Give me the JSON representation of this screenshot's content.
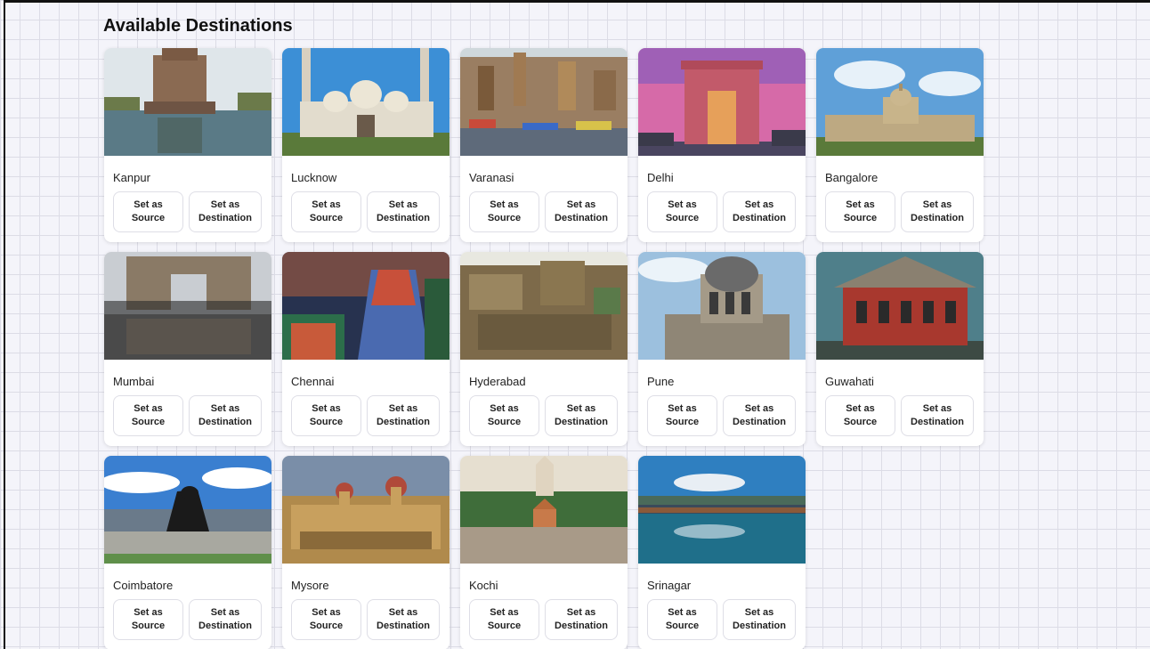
{
  "page": {
    "heading": "Available Destinations"
  },
  "buttons": {
    "source_line1": "Set as",
    "source_line2": "Source",
    "dest_line1": "Set as",
    "dest_line2": "Destination"
  },
  "destinations": [
    {
      "name": "Kanpur",
      "scene": "ghat-temple",
      "sky": "#dfe6ea",
      "ground": "#6b7a6a"
    },
    {
      "name": "Lucknow",
      "scene": "mosque",
      "sky": "#3c8fd6",
      "ground": "#a9a28c"
    },
    {
      "name": "Varanasi",
      "scene": "ghats",
      "sky": "#cfd8dc",
      "ground": "#8a6b55"
    },
    {
      "name": "Delhi",
      "scene": "gate",
      "sky": "#d66aa8",
      "ground": "#4a4560"
    },
    {
      "name": "Bangalore",
      "scene": "palace",
      "sky": "#5fa0d8",
      "ground": "#8c8a70"
    },
    {
      "name": "Mumbai",
      "scene": "gateway",
      "sky": "#c9cdd2",
      "ground": "#3b3b3b"
    },
    {
      "name": "Chennai",
      "scene": "gopuram",
      "sky": "#27324f",
      "ground": "#2c6e4a"
    },
    {
      "name": "Hyderabad",
      "scene": "fort",
      "sky": "#e8e8e0",
      "ground": "#7d6a4a"
    },
    {
      "name": "Pune",
      "scene": "dome",
      "sky": "#9cc0de",
      "ground": "#8f8676"
    },
    {
      "name": "Guwahati",
      "scene": "redbuilding",
      "sky": "#4f7f8a",
      "ground": "#3d4a44"
    },
    {
      "name": "Coimbatore",
      "scene": "statue",
      "sky": "#3a7fd0",
      "ground": "#5f8f4a"
    },
    {
      "name": "Mysore",
      "scene": "mysorepalace",
      "sky": "#7a8ea8",
      "ground": "#b08a4c"
    },
    {
      "name": "Kochi",
      "scene": "shore",
      "sky": "#e6dfd0",
      "ground": "#3f6d3a"
    },
    {
      "name": "Srinagar",
      "scene": "lake",
      "sky": "#2f7fc0",
      "ground": "#1f6f8a"
    }
  ]
}
